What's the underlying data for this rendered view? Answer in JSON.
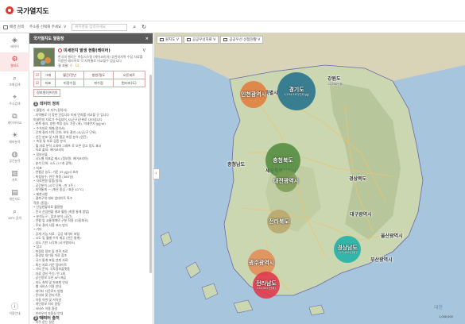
{
  "header": {
    "title": "국가열지도"
  },
  "toolbar": {
    "items": [
      "배경 검색",
      "주소를 선택해 주세요",
      "ᐯ"
    ],
    "search_placeholder": "위치명을 입력하세요"
  },
  "iconbar": {
    "items": [
      {
        "label": "레이어",
        "icon": "layers-icon"
      },
      {
        "label": "열지도",
        "icon": "heatmap-icon",
        "active": true
      },
      {
        "label": "조회검색",
        "icon": "search-icon"
      },
      {
        "label": "주소검색",
        "icon": "pin-search-icon"
      },
      {
        "label": "레이어비교",
        "icon": "compare-icon"
      },
      {
        "label": "테마분석",
        "icon": "bulb-icon"
      },
      {
        "label": "공간분석",
        "icon": "globe-icon"
      },
      {
        "label": "차트",
        "icon": "chart-icon"
      },
      {
        "label": "개인지도",
        "icon": "book-icon"
      },
      {
        "label": "WFS 검색",
        "icon": "wfs-search-icon"
      }
    ],
    "bottom": {
      "label": "이용안내",
      "icon": "info-icon"
    }
  },
  "panel": {
    "title": "국가열지도 열람창",
    "close": "×",
    "card": {
      "title": "미세먼지 발생 현황(레이어)",
      "desc": "한국의 벨리는 측정시스템 (에어코리아) 추천미지역 수집 자료를 이용한 레이어로 각 지역별로 비교할수 있습니다",
      "meta_prefix": "결 과물: ",
      "meta_value": "4 - 12"
    },
    "options": [
      [
        "그래",
        "월간/전년",
        "발현/밀도",
        "오픈세트"
      ],
      [
        "지표",
        "미정수점",
        "피수점",
        "편리지(도)"
      ]
    ],
    "source_tag": "정보원(인터넷)",
    "section_num": "1",
    "section_title": "데이터 정의",
    "info_lines": [
      "• 월평가 ·서 지수(정의서)",
      "- 지역별로 이 정한 곳입니다 미세 먼지를 비교할 곳 입니다",
      "  미세먼지 자료가 수집되어 시(군구)단위로 나타냅니다",
      "- 관측 결과, 방한 측정 농도 기준 (세), 미세먼지 (㎍/㎥)",
      "• 수치자료 체계(정의서)",
      "  - 단계 결과 지역 단위: 보유 결과 (시/군/구 단위)",
      "  - 년간 분포 및 지역 평균 측정 분석 (연간)",
      "• 측정 및 자료 검증 분석",
      "  - 월 자료 분석 소지에 그래프 로 오픈 경고 정도 표시",
      "  - 자료 출처: 에어코리아",
      "• 정보산출",
      "  - 시도별 지표값 제시 (정보원: 에어코리아)",
      "  - 분석 단위: 시도 (17개 광역)",
      "• 지표",
      "  - 연평균 농도: 기준 35 ㎍/㎥ 초과",
      "  - 측정일수: 연간 측정 (365일)",
      "• 자료변환 방법(정의)",
      "  - 공간분석 (시각 단위 : 만 3주 )",
      "  - 지역통계 ㅡ (계산 중심 / 표준 41°C)",
      "• 제한사항",
      "  - 결측구역 대비 업데이트 특수",
      "    적용 (종합)",
      "• 산업현황자료 활용형",
      "  - 전국 산업현황 결과 활용 (최종 통계 방법)",
      "• 분석도구 : 점과 분석 (공간)",
      "  - 연평 및 교통체계의 구분 적용 (다중회귀)",
      "  - 주요 결과 사용 표시 방식",
      "• 기타",
      "  - 공개 가능 자료 : 공공 데이터 포털",
      "  - 시도 및 월별 수치 제공 (연간 통계)",
      "  - 지도 기반 시각화 (국가열지도)",
      "• 참고",
      "  - 측정망 정보 및 연혁 자료",
      "  - 환경부 대기질 자료 참조",
      "  - 국가 통계 포털 연계 자료",
      "  - 최신 자료 기준 업데이트",
      "  - 기타 문의: 국토정보플랫폼",
      "  - 자료 갱신 주기: 연 1회",
      "  - 공간정보 오픈 API 제공",
      "  - 지도 축척 및 좌표계 안내",
      "  - 웹 서비스 이용 안내",
      "  - 데이터 다운로드 방법",
      "  - 문의처 및 관리기관",
      "  - 이용 약관 및 저작권",
      "  - 개인정보 처리 방침",
      "  - 서비스 이용 환경",
      "  - 브라우저 호환성 안내",
      "  - 공지사항",
      "  - 자주 묻는 질문",
      "  - 관련 사이트 바로가기",
      "  - 사이트맵"
    ],
    "footer_num": "2",
    "footer_title": "데이터 출처"
  },
  "map": {
    "toolbar": [
      "원지도 ᐯ",
      "공공우선자료 ᐯ",
      "공공우선 선점현황 ᐯ"
    ],
    "bubbles": [
      {
        "name": "경기도",
        "value": "1,234,567(단위:㎍)",
        "color": "#1f6f8b"
      },
      {
        "name": "인천광역시",
        "value": "",
        "color": "#e07b3a"
      },
      {
        "name": "충청북도",
        "value": "",
        "color": "#4f8a3c"
      },
      {
        "name": "경상남도",
        "value": "123,456(단위)",
        "color": "#20b3a8"
      },
      {
        "name": "전라남도",
        "value": "234,567(단위)",
        "color": "#e03a4e"
      },
      {
        "name": "광주광역시",
        "value": "",
        "color": "#e58a52"
      },
      {
        "name": "전라북도",
        "value": "",
        "color": "#b9a66a"
      },
      {
        "name": "대전광역시",
        "value": "",
        "color": "#7a9a55"
      }
    ],
    "cities": [
      {
        "name": "강원도",
        "value": "11,234(단위)"
      },
      {
        "name": "서울특별시",
        "value": ""
      },
      {
        "name": "충청남도",
        "value": ""
      },
      {
        "name": "세종특별자치시",
        "value": ""
      },
      {
        "name": "경상북도",
        "value": ""
      },
      {
        "name": "대구광역시",
        "value": ""
      },
      {
        "name": "울산광역시",
        "value": ""
      },
      {
        "name": "부산광역시",
        "value": ""
      },
      {
        "name": "대한",
        "value": ""
      }
    ],
    "scale": "1,000,000"
  },
  "colors": {
    "accent": "#e5352f",
    "header_bg": "#ffffff",
    "panel_head": "#5a5a5a"
  }
}
